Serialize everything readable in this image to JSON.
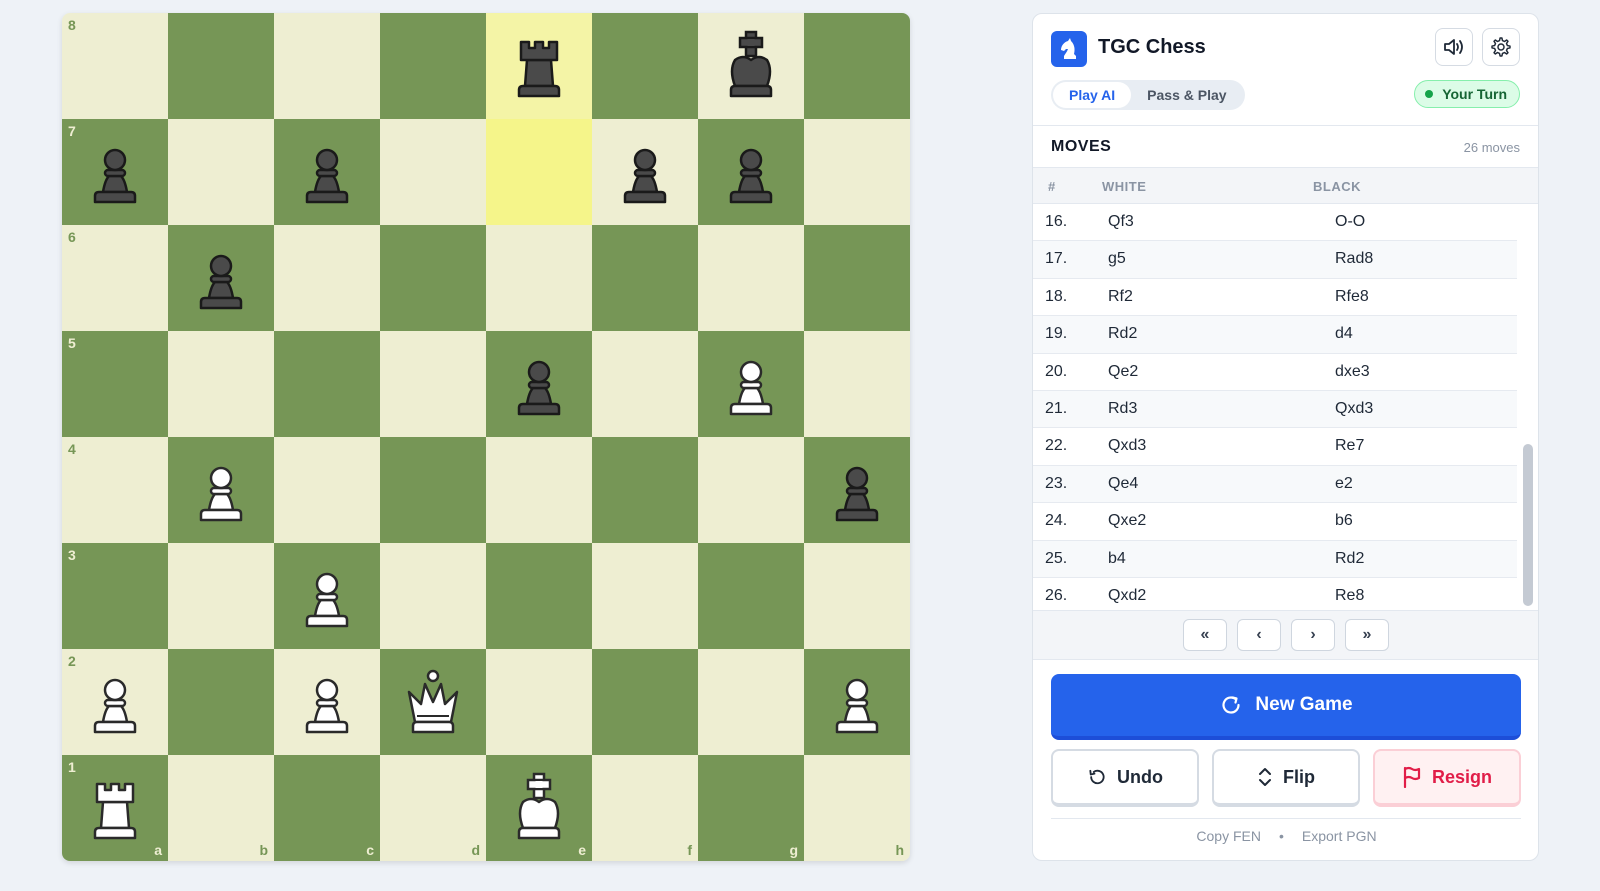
{
  "board": {
    "files": [
      "a",
      "b",
      "c",
      "d",
      "e",
      "f",
      "g",
      "h"
    ],
    "ranks": [
      "8",
      "7",
      "6",
      "5",
      "4",
      "3",
      "2",
      "1"
    ],
    "highlighted_squares": [
      "e8",
      "e7"
    ],
    "colors": {
      "light": "#eeeed2",
      "dark": "#769656",
      "highlight": "#f5f58a"
    },
    "pieces": [
      {
        "square": "e8",
        "type": "rook",
        "color": "black"
      },
      {
        "square": "g8",
        "type": "king",
        "color": "black"
      },
      {
        "square": "a7",
        "type": "pawn",
        "color": "black"
      },
      {
        "square": "c7",
        "type": "pawn",
        "color": "black"
      },
      {
        "square": "f7",
        "type": "pawn",
        "color": "black"
      },
      {
        "square": "g7",
        "type": "pawn",
        "color": "black"
      },
      {
        "square": "b6",
        "type": "pawn",
        "color": "black"
      },
      {
        "square": "e5",
        "type": "pawn",
        "color": "black"
      },
      {
        "square": "g5",
        "type": "pawn",
        "color": "white"
      },
      {
        "square": "b4",
        "type": "pawn",
        "color": "white"
      },
      {
        "square": "h4",
        "type": "pawn",
        "color": "black"
      },
      {
        "square": "c3",
        "type": "pawn",
        "color": "white"
      },
      {
        "square": "a2",
        "type": "pawn",
        "color": "white"
      },
      {
        "square": "c2",
        "type": "pawn",
        "color": "white"
      },
      {
        "square": "d2",
        "type": "queen",
        "color": "white"
      },
      {
        "square": "h2",
        "type": "pawn",
        "color": "white"
      },
      {
        "square": "a1",
        "type": "rook",
        "color": "white"
      },
      {
        "square": "e1",
        "type": "king",
        "color": "white"
      }
    ]
  },
  "header": {
    "logo_icon": "knight-icon",
    "title": "TGC Chess",
    "sound_icon": "speaker-icon",
    "settings_icon": "gear-icon",
    "modes": [
      "Play AI",
      "Pass & Play"
    ],
    "active_mode": "Play AI",
    "turn_badge": "Your Turn",
    "accent": "#2563eb"
  },
  "moves": {
    "title": "MOVES",
    "count_label": "26 moves",
    "columns": {
      "num": "#",
      "white": "WHITE",
      "black": "BLACK"
    },
    "rows": [
      {
        "num": "16.",
        "white": "Qf3",
        "black": "O-O"
      },
      {
        "num": "17.",
        "white": "g5",
        "black": "Rad8"
      },
      {
        "num": "18.",
        "white": "Rf2",
        "black": "Rfe8"
      },
      {
        "num": "19.",
        "white": "Rd2",
        "black": "d4"
      },
      {
        "num": "20.",
        "white": "Qe2",
        "black": "dxe3"
      },
      {
        "num": "21.",
        "white": "Rd3",
        "black": "Qxd3"
      },
      {
        "num": "22.",
        "white": "Qxd3",
        "black": "Re7"
      },
      {
        "num": "23.",
        "white": "Qe4",
        "black": "e2"
      },
      {
        "num": "24.",
        "white": "Qxe2",
        "black": "b6"
      },
      {
        "num": "25.",
        "white": "b4",
        "black": "Rd2"
      },
      {
        "num": "26.",
        "white": "Qxd2",
        "black": "Re8"
      }
    ]
  },
  "nav": {
    "first": "«",
    "prev": "‹",
    "next": "›",
    "last": "»"
  },
  "actions": {
    "new_game": "New Game",
    "undo": "Undo",
    "flip": "Flip",
    "resign": "Resign",
    "resign_color": "#e11d48"
  },
  "footer": {
    "copy_fen": "Copy FEN",
    "separator": "•",
    "export_pgn": "Export PGN"
  }
}
